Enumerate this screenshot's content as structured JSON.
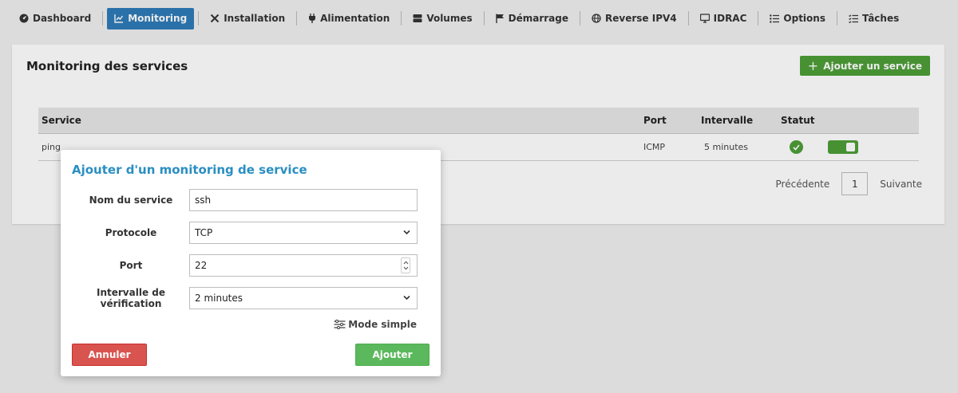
{
  "nav": {
    "items": [
      {
        "label": "Dashboard",
        "icon": "dashboard-icon",
        "active": false
      },
      {
        "label": "Monitoring",
        "icon": "chart-line-icon",
        "active": true
      },
      {
        "label": "Installation",
        "icon": "tools-icon",
        "active": false
      },
      {
        "label": "Alimentation",
        "icon": "plug-icon",
        "active": false
      },
      {
        "label": "Volumes",
        "icon": "database-icon",
        "active": false
      },
      {
        "label": "Démarrage",
        "icon": "flag-icon",
        "active": false
      },
      {
        "label": "Reverse IPV4",
        "icon": "globe-icon",
        "active": false
      },
      {
        "label": "IDRAC",
        "icon": "monitor-icon",
        "active": false
      },
      {
        "label": "Options",
        "icon": "list-icon",
        "active": false
      },
      {
        "label": "Tâches",
        "icon": "task-list-icon",
        "active": false
      }
    ]
  },
  "page": {
    "title": "Monitoring des services",
    "add_button_label": "Ajouter un service"
  },
  "table": {
    "headers": {
      "service": "Service",
      "port": "Port",
      "interval": "Intervalle",
      "status": "Statut"
    },
    "rows": [
      {
        "service": "ping",
        "port": "ICMP",
        "interval": "5 minutes",
        "status": "ok",
        "enabled": true
      }
    ]
  },
  "pager": {
    "prev": "Précédente",
    "page": "1",
    "next": "Suivante"
  },
  "modal": {
    "title": "Ajouter d'un monitoring de service",
    "service_name_label": "Nom du service",
    "service_name_value": "ssh",
    "protocol_label": "Protocole",
    "protocol_value": "TCP",
    "port_label": "Port",
    "port_value": "22",
    "interval_label": "Intervalle de vérification",
    "interval_value": "2 minutes",
    "mode_simple_label": "Mode simple",
    "cancel_label": "Annuler",
    "add_label": "Ajouter"
  },
  "colors": {
    "primary": "#2f7bb8",
    "success": "#4e9e38",
    "danger": "#d9534f",
    "modal_title": "#2a8ec2"
  }
}
